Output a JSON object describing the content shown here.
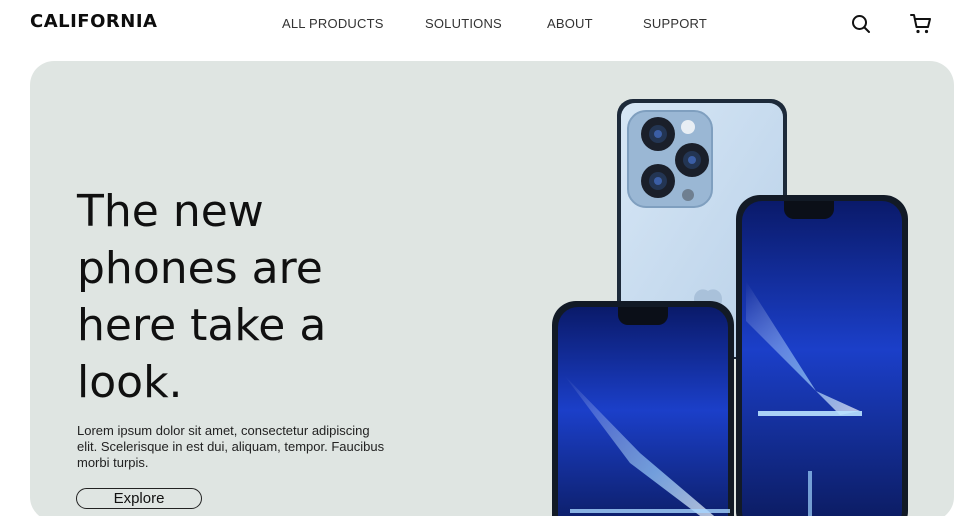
{
  "brand": {
    "logo_text": "CALIFORNIA"
  },
  "nav": {
    "links": [
      "ALL PRODUCTS",
      "SOLUTIONS",
      "ABOUT",
      "SUPPORT"
    ],
    "icons": [
      "search-icon",
      "cart-icon"
    ]
  },
  "hero": {
    "title": "The new phones are here take a look.",
    "body": "Lorem ipsum dolor sit amet, consectetur adipiscing elit. Scelerisque in est dui, aliquam, tempor. Faucibus morbi turpis.",
    "cta_label": "Explore",
    "background_color": "#dfe5e2",
    "image": "three-smartphones-blue"
  }
}
